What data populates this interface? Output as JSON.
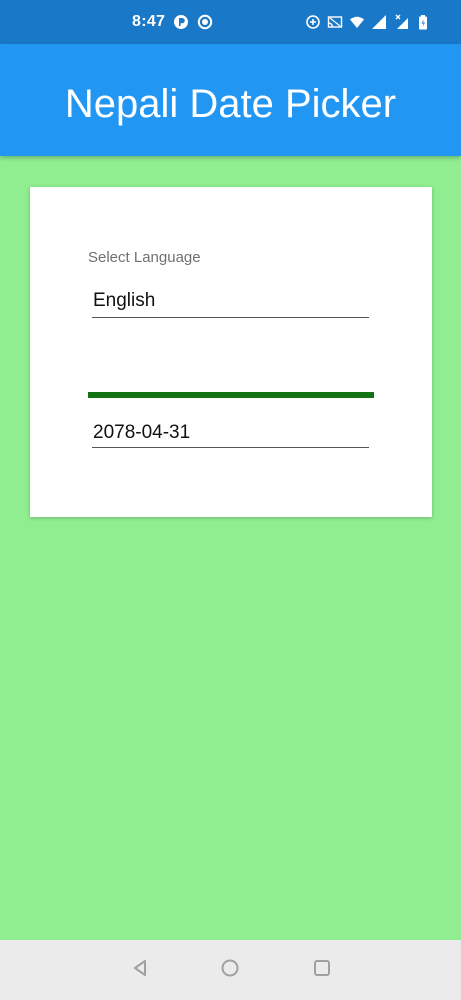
{
  "status_bar": {
    "time": "8:47",
    "icons": [
      "app-notification-icon",
      "record-icon",
      "sync-icon",
      "cast-icon",
      "wifi-icon",
      "signal-icon",
      "signal-no-data-icon",
      "battery-icon"
    ]
  },
  "app_bar": {
    "title": "Nepali Date Picker"
  },
  "card": {
    "language_label": "Select Language",
    "language_value": "English",
    "progress": 1.0,
    "date_value": "2078-04-31"
  },
  "nav_bar": {
    "buttons": [
      "back-icon",
      "home-icon",
      "recents-icon"
    ]
  },
  "colors": {
    "status_bar": "#1a78c8",
    "app_bar": "#2196f3",
    "background": "#90ee90",
    "progress": "#127312"
  }
}
